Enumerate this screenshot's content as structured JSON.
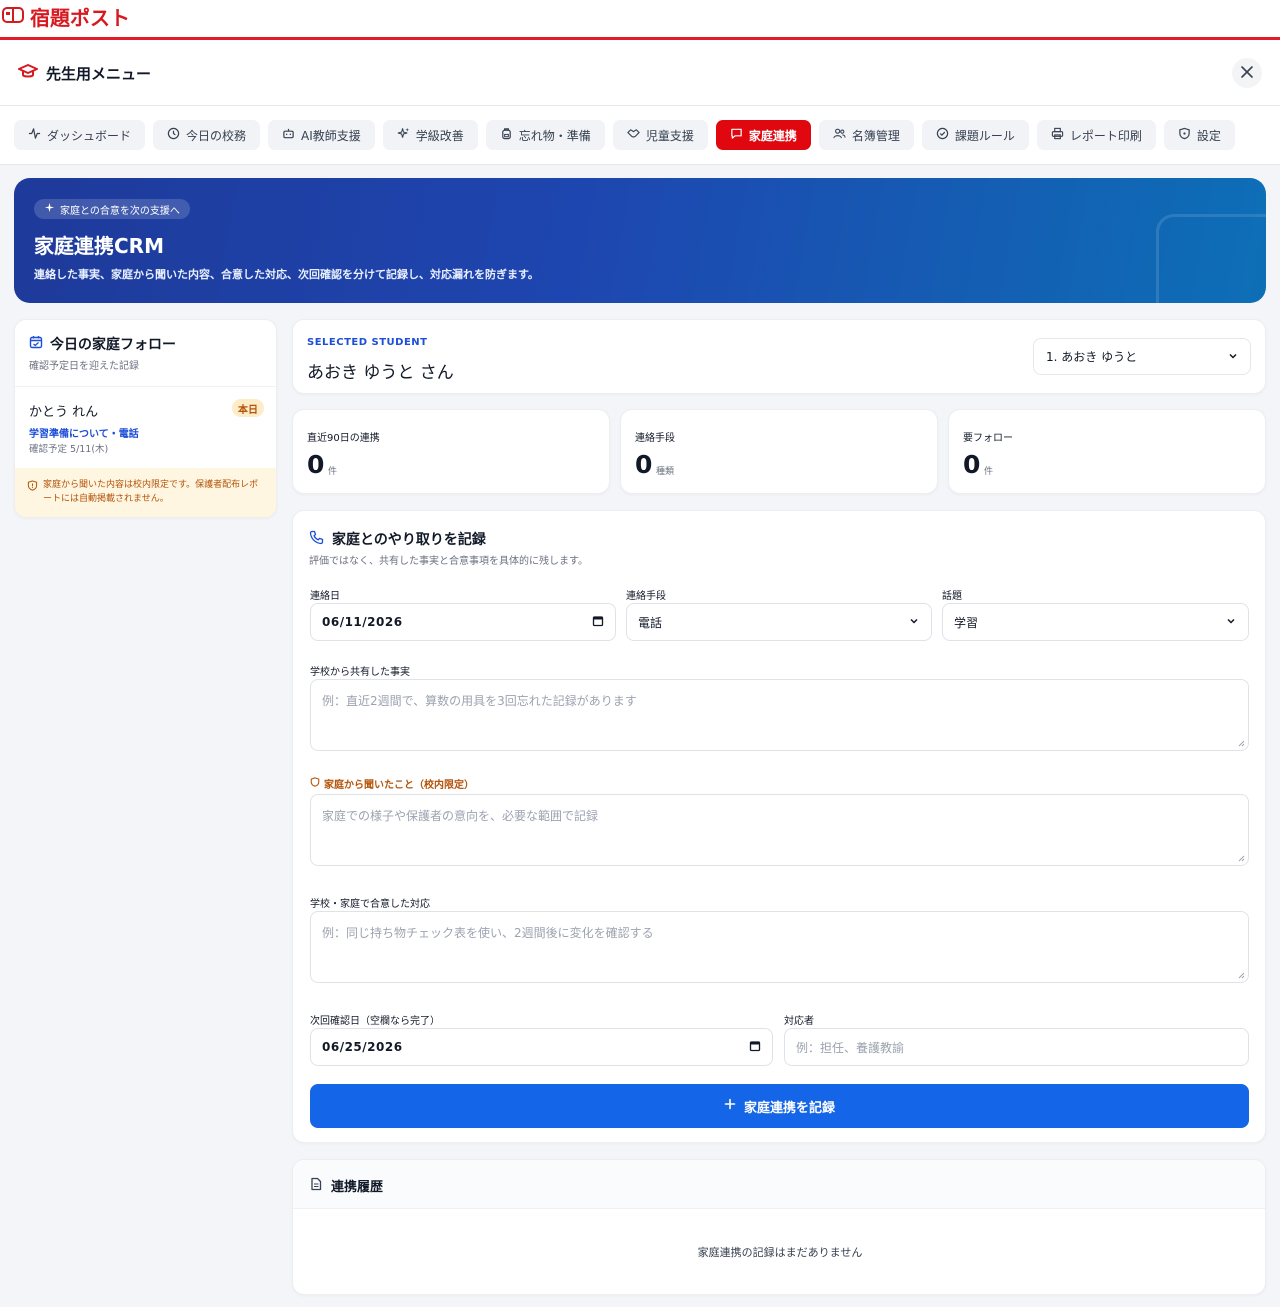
{
  "brand": {
    "name": "宿題ポスト"
  },
  "menu": {
    "title": "先生用メニュー"
  },
  "nav": [
    {
      "label": "ダッシュボード",
      "icon": "activity-icon"
    },
    {
      "label": "今日の校務",
      "icon": "clock-icon"
    },
    {
      "label": "AI教師支援",
      "icon": "bot-icon"
    },
    {
      "label": "学級改善",
      "icon": "sparkles-icon"
    },
    {
      "label": "忘れ物・準備",
      "icon": "backpack-icon"
    },
    {
      "label": "児童支援",
      "icon": "handshake-icon"
    },
    {
      "label": "家庭連携",
      "icon": "message-icon",
      "active": true
    },
    {
      "label": "名簿管理",
      "icon": "users-icon"
    },
    {
      "label": "課題ルール",
      "icon": "check-circle-icon"
    },
    {
      "label": "レポート印刷",
      "icon": "printer-icon"
    },
    {
      "label": "設定",
      "icon": "shield-icon"
    }
  ],
  "hero": {
    "pill": "家庭との合意を次の支援へ",
    "title": "家庭連携CRM",
    "description": "連絡した事実、家庭から聞いた内容、合意した対応、次回確認を分けて記録し、対応漏れを防ぎます。"
  },
  "followup": {
    "title": "今日の家庭フォロー",
    "subtitle": "確認予定日を迎えた記録",
    "items": [
      {
        "name": "かとう れん",
        "badge": "本日",
        "topic": "学習準備について・電話",
        "due": "確認予定 5/11(木)"
      }
    ],
    "note": "家庭から聞いた内容は校内限定です。保護者配布レポートには自動掲載されません。"
  },
  "student": {
    "label": "SELECTED STUDENT",
    "name": "あおき ゆうと さん",
    "select_value": "1. あおき ゆうと"
  },
  "stats": [
    {
      "label": "直近90日の連携",
      "value": "0",
      "unit": "件"
    },
    {
      "label": "連絡手段",
      "value": "0",
      "unit": "種類"
    },
    {
      "label": "要フォロー",
      "value": "0",
      "unit": "件"
    }
  ],
  "form": {
    "title": "家庭とのやり取りを記録",
    "subtitle": "評価ではなく、共有した事実と合意事項を具体的に残します。",
    "date_label": "連絡日",
    "date_value": "06/11/2026",
    "method_label": "連絡手段",
    "method_value": "電話",
    "topic_label": "話題",
    "topic_value": "学習",
    "fact_label": "学校から共有した事実",
    "fact_placeholder": "例：直近2週間で、算数の用具を3回忘れた記録があります",
    "heard_label": "家庭から聞いたこと（校内限定）",
    "heard_placeholder": "家庭での様子や保護者の意向を、必要な範囲で記録",
    "agreed_label": "学校・家庭で合意した対応",
    "agreed_placeholder": "例：同じ持ち物チェック表を使い、2週間後に変化を確認する",
    "next_label": "次回確認日（空欄なら完了）",
    "next_value": "06/25/2026",
    "owner_label": "対応者",
    "owner_placeholder": "例：担任、養護教諭",
    "submit_label": "家庭連携を記録"
  },
  "history": {
    "title": "連携履歴",
    "empty": "家庭連携の記録はまだありません"
  },
  "colors": {
    "brand_red": "#e0070f",
    "accent_blue": "#1565e8",
    "hero_start": "#1e3a9a",
    "hero_end": "#0d6fb6",
    "warn": "#b45309"
  }
}
